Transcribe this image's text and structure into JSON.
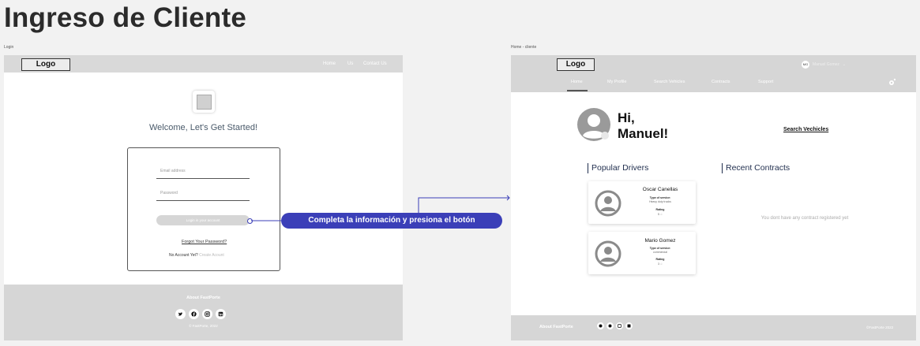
{
  "page_title": "Ingreso de Cliente",
  "login_frame": {
    "frame_label": "Login",
    "logo": "Logo",
    "nav": [
      "Home",
      "Us",
      "Contact Us"
    ],
    "welcome": "Welcome, Let's Get Started!",
    "email_placeholder": "Email address",
    "password_placeholder": "Password",
    "login_button": "Login in your account",
    "forgot": "Forgot Your Password?",
    "no_account": "No Account Yet?",
    "create_account": "Create Acount",
    "footer_title": "About FastPorte",
    "social_icons": [
      "twitter-icon",
      "facebook-icon",
      "instagram-icon",
      "linkedin-icon"
    ],
    "copyright": "© FastPorte, 2022"
  },
  "annotation": {
    "callout": "Completa  la información y presiona el botón"
  },
  "home_frame": {
    "frame_label": "Home - cliente",
    "logo": "Logo",
    "user_initials": "MG",
    "user_name": "Manuel Gomez",
    "nav": [
      "Home",
      "My Profile",
      "Search Vehicles",
      "Contracts",
      "Support"
    ],
    "greeting_line1": "Hi,",
    "greeting_line2": "Manuel!",
    "search_link": "Search Vechicles",
    "popular_drivers_title": "Popular Drivers",
    "recent_contracts_title": "Recent Contracts",
    "drivers": [
      {
        "name": "Oscar Canellas",
        "service_label": "Type of service:",
        "service": "Heavy duty trucks",
        "rating_label": "Rating",
        "rating": "5 ☆"
      },
      {
        "name": "Mario Gomez",
        "service_label": "Type of service:",
        "service": "commercial",
        "rating_label": "Rating",
        "rating": "3 ☆"
      }
    ],
    "no_contracts": "You dont have any contract registered yet",
    "footer_title": "About FastPorte",
    "copyright": "©FastPorte 2022"
  },
  "colors": {
    "accent": "#3b3fb8",
    "nav_gray": "#d9d9d9",
    "section_heading": "#1f2d4d"
  }
}
